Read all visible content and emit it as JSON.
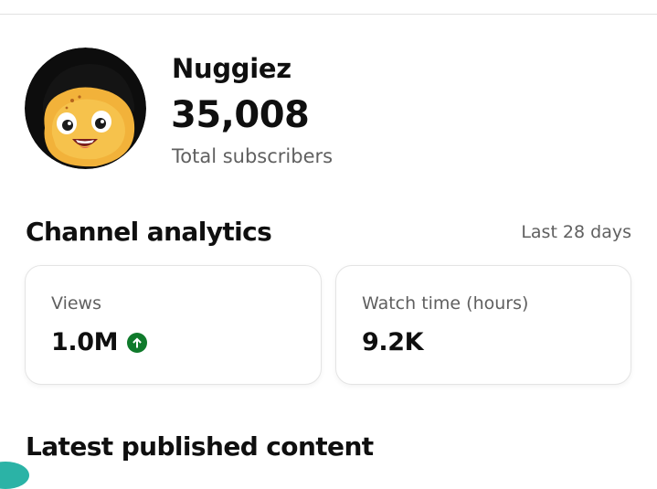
{
  "channel": {
    "name": "Nuggiez",
    "subscriber_count": "35,008",
    "subscriber_label": "Total subscribers",
    "avatar_icon": "nugget-character-avatar"
  },
  "analytics": {
    "title": "Channel analytics",
    "period": "Last 28 days",
    "cards": [
      {
        "label": "Views",
        "value": "1.0M",
        "trend": "up",
        "trend_color": "#0f7a2b"
      },
      {
        "label": "Watch time (hours)",
        "value": "9.2K"
      }
    ]
  },
  "latest": {
    "title": "Latest published content"
  },
  "colors": {
    "text_primary": "#0f0f0f",
    "text_secondary": "#606060",
    "trend_up": "#0f7a2b",
    "accent_teal": "#2bb3a6"
  }
}
